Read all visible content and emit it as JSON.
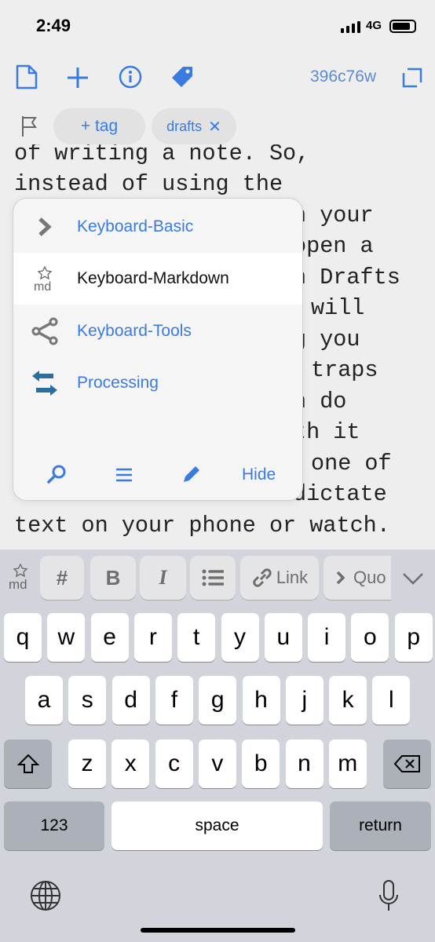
{
  "status": {
    "time": "2:49",
    "network": "4G"
  },
  "toolbar": {
    "icons": [
      "document-icon",
      "plus-icon",
      "info-icon",
      "tag-icon"
    ],
    "hash": "396c76w",
    "expand_icon": "expand-icon"
  },
  "tags": {
    "add_tag": "+ tag",
    "tags": [
      "drafts"
    ]
  },
  "editor": {
    "lines": [
      "of writing a note. So,",
      "instead of using the",
      "n your",
      "open a",
      "n Drafts",
      "will",
      "g you",
      "traps",
      "n do",
      "th it",
      "one of",
      "dictate",
      "text on your phone or watch."
    ]
  },
  "menu": {
    "items": [
      {
        "label": "Keyboard-Basic",
        "icon": "chevron-right-icon"
      },
      {
        "label": "Keyboard-Markdown",
        "icon": "markdown-icon",
        "selected": true
      },
      {
        "label": "Keyboard-Tools",
        "icon": "share-icon"
      },
      {
        "label": "Processing",
        "icon": "arrows-swap-icon"
      }
    ],
    "hide": "Hide"
  },
  "extra_keys": {
    "heading": "#",
    "bold": "B",
    "italic": "I",
    "link": "Link",
    "quote": "Quo"
  },
  "keyboard": {
    "row1": [
      "q",
      "w",
      "e",
      "r",
      "t",
      "y",
      "u",
      "i",
      "o",
      "p"
    ],
    "row2": [
      "a",
      "s",
      "d",
      "f",
      "g",
      "h",
      "j",
      "k",
      "l"
    ],
    "row3": [
      "z",
      "x",
      "c",
      "v",
      "b",
      "n",
      "m"
    ],
    "numbers": "123",
    "space": "space",
    "return": "return"
  },
  "colors": {
    "accent": "#3a7be0",
    "keyboard_bg": "#d1d4da"
  }
}
